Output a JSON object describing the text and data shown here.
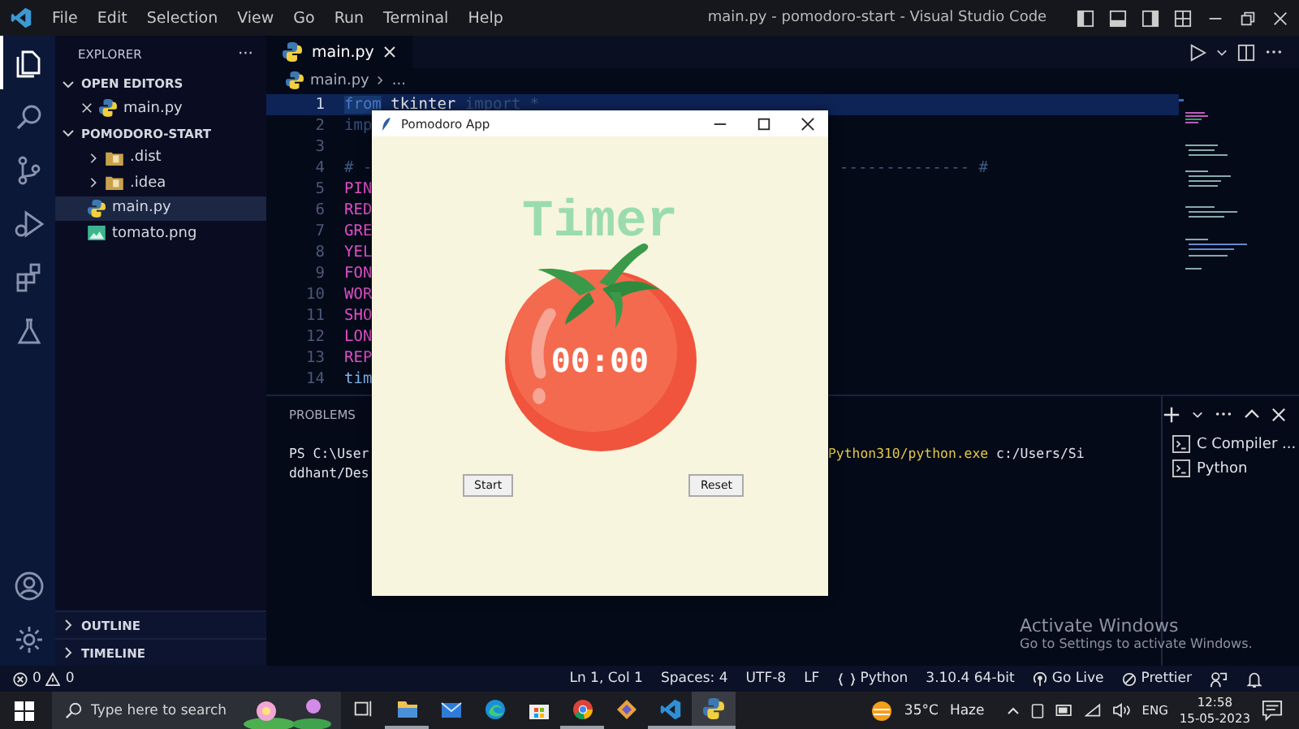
{
  "title_bar": {
    "menu": [
      "File",
      "Edit",
      "Selection",
      "View",
      "Go",
      "Run",
      "Terminal",
      "Help"
    ],
    "title": "main.py - pomodoro-start - Visual Studio Code"
  },
  "activity_bar": {
    "items": [
      {
        "kind": "explorer",
        "selected": true
      },
      {
        "kind": "search",
        "selected": false
      },
      {
        "kind": "source-control",
        "selected": false
      },
      {
        "kind": "run",
        "selected": false
      },
      {
        "kind": "extensions",
        "selected": false
      },
      {
        "kind": "testing",
        "selected": false
      }
    ],
    "bottom": [
      {
        "kind": "accounts"
      },
      {
        "kind": "settings"
      }
    ]
  },
  "sidebar": {
    "title": "EXPLORER",
    "more": "···",
    "sections": [
      {
        "label": "OPEN EDITORS",
        "expanded": true,
        "items": [
          {
            "label": "main.py",
            "kind": "python",
            "selected": false,
            "closable": true
          }
        ]
      },
      {
        "label": "POMODORO-START",
        "expanded": true,
        "items": [
          {
            "label": ".dist",
            "kind": "folder",
            "selected": false,
            "closable": false
          },
          {
            "label": ".idea",
            "kind": "folder",
            "selected": false,
            "closable": false
          },
          {
            "label": "main.py",
            "kind": "python",
            "selected": true,
            "closable": false
          },
          {
            "label": "tomato.png",
            "kind": "image",
            "selected": false,
            "closable": false
          }
        ]
      }
    ],
    "bottom_sections": [
      {
        "label": "OUTLINE",
        "expanded": false
      },
      {
        "label": "TIMELINE",
        "expanded": false
      }
    ]
  },
  "editor": {
    "tabs": [
      {
        "label": "main.py",
        "selected": true
      }
    ],
    "breadcrumb": [
      "main.py",
      "..."
    ],
    "lines": [
      {
        "number": "1",
        "current": true,
        "tokens": [
          {
            "text": "from",
            "kind": "keyword"
          },
          {
            "text": " tkinter ",
            "kind": "name"
          },
          {
            "text": "import *",
            "kind": "faint"
          }
        ]
      },
      {
        "number": "2",
        "current": false,
        "tokens": [
          {
            "text": "imp",
            "kind": "faint"
          }
        ]
      },
      {
        "number": "3",
        "current": false
      },
      {
        "number": "4",
        "current": false,
        "tokens": [
          {
            "text": "# -",
            "kind": "comment"
          }
        ],
        "tail": "-------------- #"
      },
      {
        "number": "5",
        "current": false,
        "tokens": [
          {
            "text": "PIN",
            "kind": "constant"
          }
        ]
      },
      {
        "number": "6",
        "current": false,
        "tokens": [
          {
            "text": "RED",
            "kind": "constant"
          }
        ]
      },
      {
        "number": "7",
        "current": false,
        "tokens": [
          {
            "text": "GRE",
            "kind": "constant"
          }
        ]
      },
      {
        "number": "8",
        "current": false,
        "tokens": [
          {
            "text": "YEL",
            "kind": "constant"
          }
        ]
      },
      {
        "number": "9",
        "current": false,
        "tokens": [
          {
            "text": "FON",
            "kind": "constant"
          }
        ]
      },
      {
        "number": "10",
        "current": false,
        "tokens": [
          {
            "text": "WOR",
            "kind": "constant"
          }
        ]
      },
      {
        "number": "11",
        "current": false,
        "tokens": [
          {
            "text": "SHO",
            "kind": "constant"
          }
        ]
      },
      {
        "number": "12",
        "current": false,
        "tokens": [
          {
            "text": "LON",
            "kind": "constant"
          }
        ]
      },
      {
        "number": "13",
        "current": false,
        "tokens": [
          {
            "text": "REP",
            "kind": "constant"
          }
        ]
      },
      {
        "number": "14",
        "current": false,
        "tokens": [
          {
            "text": "tim",
            "kind": "variable"
          }
        ]
      }
    ]
  },
  "panel": {
    "title": "PROBLEMS",
    "terminal_lines": [
      {
        "left": "PS C:\\User",
        "right": [
          {
            "text": "Python310/python.exe",
            "kind": "path"
          },
          {
            "text": " c:/Users/Si",
            "kind": "plain"
          }
        ]
      },
      {
        "left": "ddhant/Des"
      }
    ],
    "terminals": [
      {
        "label": "C Compiler ..."
      },
      {
        "label": "Python"
      }
    ]
  },
  "app_window": {
    "title": "Pomodoro App",
    "heading": "Timer",
    "time": "00:00",
    "buttons": [
      "Start",
      "Reset"
    ]
  },
  "activation_notice": {
    "title": "Activate Windows",
    "subtitle": "Go to Settings to activate Windows."
  },
  "status_bar": {
    "errors": "0",
    "warnings": "0",
    "items": [
      {
        "kind": "text",
        "label": "Ln 1, Col 1"
      },
      {
        "kind": "text",
        "label": "Spaces: 4"
      },
      {
        "kind": "text",
        "label": "UTF-8"
      },
      {
        "kind": "text",
        "label": "LF"
      },
      {
        "kind": "language",
        "label": "Python"
      },
      {
        "kind": "text",
        "label": "3.10.4 64-bit"
      },
      {
        "kind": "live",
        "label": "Go Live"
      },
      {
        "kind": "prettier",
        "label": "Prettier"
      },
      {
        "kind": "feedback"
      },
      {
        "kind": "bell"
      }
    ]
  },
  "taskbar": {
    "search": {
      "placeholder": "Type here to search"
    },
    "apps": [
      {
        "kind": "task-view",
        "running": false,
        "selected": false
      },
      {
        "kind": "files",
        "running": true,
        "selected": false
      },
      {
        "kind": "mail",
        "running": false,
        "selected": false
      },
      {
        "kind": "edge",
        "running": false,
        "selected": false
      },
      {
        "kind": "store",
        "running": false,
        "selected": false
      },
      {
        "kind": "chrome",
        "running": true,
        "selected": false
      },
      {
        "kind": "git",
        "running": false,
        "selected": false
      },
      {
        "kind": "vscode",
        "running": true,
        "selected": false
      },
      {
        "kind": "python",
        "running": true,
        "selected": true
      }
    ],
    "weather": {
      "temperature": "35°C",
      "condition": "Haze"
    },
    "language": "ENG",
    "time": "12:58",
    "date": "15-05-2023"
  }
}
